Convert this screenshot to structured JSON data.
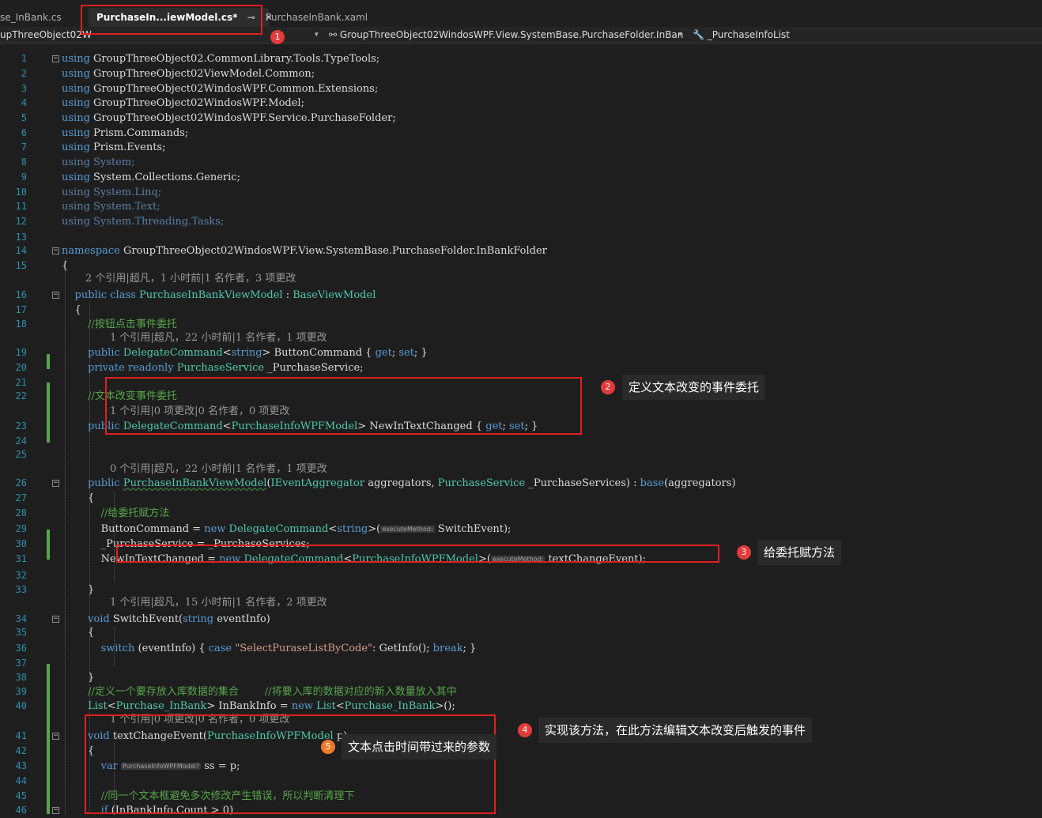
{
  "tabs": [
    {
      "label": "se_InBank.cs",
      "active": false
    },
    {
      "label": "PurchaseIn...iewModel.cs*",
      "active": true
    },
    {
      "label": "PurchaseInBank.xaml",
      "active": false
    }
  ],
  "tab_controls": {
    "pin": "⊸",
    "close": "✕"
  },
  "navbar": {
    "project": "upThreeObject02W",
    "class_path": "GroupThreeObject02WindosWPF.View.SystemBase.PurchaseFolder.InBan",
    "member": "_PurchaseInfoList"
  },
  "code_lines": [
    {
      "n": "1",
      "t": [
        [
          "kw",
          "using"
        ],
        [
          "id",
          " GroupThreeObject02.CommonLibrary.Tools.TypeTools;"
        ]
      ]
    },
    {
      "n": "2",
      "t": [
        [
          "kw",
          "using"
        ],
        [
          "id",
          " GroupThreeObject02ViewModel.Common;"
        ]
      ]
    },
    {
      "n": "3",
      "t": [
        [
          "kw",
          "using"
        ],
        [
          "id",
          " GroupThreeObject02WindosWPF.Common.Extensions;"
        ]
      ]
    },
    {
      "n": "4",
      "t": [
        [
          "kw",
          "using"
        ],
        [
          "id",
          " GroupThreeObject02WindosWPF.Model;"
        ]
      ]
    },
    {
      "n": "5",
      "t": [
        [
          "kw",
          "using"
        ],
        [
          "id",
          " GroupThreeObject02WindosWPF.Service.PurchaseFolder;"
        ]
      ]
    },
    {
      "n": "6",
      "t": [
        [
          "kw",
          "using"
        ],
        [
          "id",
          " Prism.Commands;"
        ]
      ]
    },
    {
      "n": "7",
      "t": [
        [
          "kw",
          "using"
        ],
        [
          "id",
          " Prism.Events;"
        ]
      ]
    },
    {
      "n": "8",
      "t": [
        [
          "dim",
          "using System;"
        ]
      ]
    },
    {
      "n": "9",
      "t": [
        [
          "kw",
          "using"
        ],
        [
          "id",
          " System.Collections.Generic;"
        ]
      ]
    },
    {
      "n": "10",
      "t": [
        [
          "dim",
          "using System.Linq;"
        ]
      ]
    },
    {
      "n": "11",
      "t": [
        [
          "dim",
          "using System.Text;"
        ]
      ]
    },
    {
      "n": "12",
      "t": [
        [
          "dim",
          "using System.Threading.Tasks;"
        ]
      ]
    },
    {
      "n": "13",
      "t": []
    },
    {
      "n": "14",
      "t": [
        [
          "kw",
          "namespace"
        ],
        [
          "id",
          " GroupThreeObject02WindosWPF.View.SystemBase.PurchaseFolder.InBankFolder"
        ]
      ]
    },
    {
      "n": "15",
      "t": [
        [
          "id",
          "{"
        ]
      ]
    },
    {
      "lens": "2 个引用|超凡，1 小时前|1 名作者，3 项更改",
      "indent": 2
    },
    {
      "n": "16",
      "t": [
        [
          "id",
          "    "
        ],
        [
          "kw",
          "public class"
        ],
        [
          "id",
          " "
        ],
        [
          "ty",
          "PurchaseInBankViewModel"
        ],
        [
          "id",
          " : "
        ],
        [
          "ty",
          "BaseViewModel"
        ]
      ]
    },
    {
      "n": "17",
      "t": [
        [
          "id",
          "    {"
        ]
      ]
    },
    {
      "n": "18",
      "t": [
        [
          "id",
          "        "
        ],
        [
          "cm",
          "//按钮点击事件委托"
        ]
      ]
    },
    {
      "lens": "1 个引用|超凡，22 小时前|1 名作者，1 项更改",
      "indent": 4
    },
    {
      "n": "19",
      "t": [
        [
          "id",
          "        "
        ],
        [
          "kw",
          "public"
        ],
        [
          "id",
          " "
        ],
        [
          "ty",
          "DelegateCommand"
        ],
        [
          "id",
          "<"
        ],
        [
          "kw",
          "string"
        ],
        [
          "id",
          "> ButtonCommand { "
        ],
        [
          "kw",
          "get"
        ],
        [
          "id",
          "; "
        ],
        [
          "kw",
          "set"
        ],
        [
          "id",
          "; }"
        ]
      ]
    },
    {
      "n": "20",
      "t": [
        [
          "id",
          "        "
        ],
        [
          "kw",
          "private readonly"
        ],
        [
          "id",
          " "
        ],
        [
          "ty",
          "PurchaseService"
        ],
        [
          "id",
          " _PurchaseService;"
        ]
      ]
    },
    {
      "n": "21",
      "t": []
    },
    {
      "n": "22",
      "t": [
        [
          "id",
          "        "
        ],
        [
          "cm",
          "//文本改变事件委托"
        ]
      ]
    },
    {
      "lens": "1 个引用|0 项更改|0 名作者，0 项更改",
      "indent": 4
    },
    {
      "n": "23",
      "t": [
        [
          "id",
          "        "
        ],
        [
          "kw",
          "public"
        ],
        [
          "id",
          " "
        ],
        [
          "ty",
          "DelegateCommand"
        ],
        [
          "id",
          "<"
        ],
        [
          "ty",
          "PurchaseInfoWPFModel"
        ],
        [
          "id",
          "> NewInTextChanged { "
        ],
        [
          "kw",
          "get"
        ],
        [
          "id",
          "; "
        ],
        [
          "kw",
          "set"
        ],
        [
          "id",
          "; }"
        ]
      ]
    },
    {
      "n": "24",
      "t": []
    },
    {
      "n": "25",
      "t": []
    },
    {
      "lens": "0 个引用|超凡，22 小时前|1 名作者，1 项更改",
      "indent": 4
    },
    {
      "n": "26",
      "t": [
        [
          "id",
          "        "
        ],
        [
          "kw",
          "public"
        ],
        [
          "id",
          " "
        ],
        [
          "ty",
          "PurchaseInBankViewModel"
        ],
        [
          "id",
          "("
        ],
        [
          "ty",
          "IEventAggregator"
        ],
        [
          "id",
          " aggregators, "
        ],
        [
          "ty",
          "PurchaseService"
        ],
        [
          "id",
          " _PurchaseServices) : "
        ],
        [
          "kw",
          "base"
        ],
        [
          "id",
          "(aggregators)"
        ]
      ]
    },
    {
      "n": "27",
      "t": [
        [
          "id",
          "        {"
        ]
      ]
    },
    {
      "n": "28",
      "t": [
        [
          "id",
          "            "
        ],
        [
          "cm",
          "//给委托赋方法"
        ]
      ]
    },
    {
      "n": "29",
      "t": [
        [
          "id",
          "            ButtonCommand = "
        ],
        [
          "kw",
          "new"
        ],
        [
          "id",
          " "
        ],
        [
          "ty",
          "DelegateCommand"
        ],
        [
          "id",
          "<"
        ],
        [
          "kw",
          "string"
        ],
        [
          "id",
          ">("
        ],
        [
          "hint",
          "executeMethod:"
        ],
        [
          "id",
          " SwitchEvent);"
        ]
      ]
    },
    {
      "n": "30",
      "t": [
        [
          "id",
          "            _PurchaseService = _PurchaseServices;"
        ]
      ]
    },
    {
      "n": "31",
      "t": [
        [
          "id",
          "            NewInTextChanged = "
        ],
        [
          "kw",
          "new"
        ],
        [
          "id",
          " "
        ],
        [
          "ty",
          "DelegateCommand"
        ],
        [
          "id",
          "<"
        ],
        [
          "ty",
          "PurchaseInfoWPFModel"
        ],
        [
          "id",
          ">("
        ],
        [
          "hint",
          "executeMethod:"
        ],
        [
          "id",
          " textChangeEvent);"
        ]
      ]
    },
    {
      "n": "32",
      "t": []
    },
    {
      "n": "33",
      "t": [
        [
          "id",
          "        }"
        ]
      ]
    },
    {
      "lens": "1 个引用|超凡，15 小时前|1 名作者，2 项更改",
      "indent": 4
    },
    {
      "n": "34",
      "t": [
        [
          "id",
          "        "
        ],
        [
          "kw",
          "void"
        ],
        [
          "id",
          " SwitchEvent("
        ],
        [
          "kw",
          "string"
        ],
        [
          "id",
          " eventInfo)"
        ]
      ]
    },
    {
      "n": "35",
      "t": [
        [
          "id",
          "        {"
        ]
      ]
    },
    {
      "n": "36",
      "t": [
        [
          "id",
          "            "
        ],
        [
          "kw",
          "switch"
        ],
        [
          "id",
          " (eventInfo) { "
        ],
        [
          "kw",
          "case"
        ],
        [
          "id",
          " "
        ],
        [
          "st",
          "\"SelectPuraseListByCode\""
        ],
        [
          "id",
          ": GetInfo(); "
        ],
        [
          "kw",
          "break"
        ],
        [
          "id",
          "; }"
        ]
      ]
    },
    {
      "n": "37",
      "t": []
    },
    {
      "n": "38",
      "t": [
        [
          "id",
          "        }"
        ]
      ]
    },
    {
      "n": "39",
      "t": [
        [
          "id",
          "        "
        ],
        [
          "cm",
          "//定义一个要存放入库数据的集合        //将要入库的数据对应的新入数量放入其中"
        ]
      ]
    },
    {
      "n": "40",
      "t": [
        [
          "id",
          "        "
        ],
        [
          "ty",
          "List"
        ],
        [
          "id",
          "<"
        ],
        [
          "ty",
          "Purchase_InBank"
        ],
        [
          "id",
          "> InBankInfo = "
        ],
        [
          "kw",
          "new"
        ],
        [
          "id",
          " "
        ],
        [
          "ty",
          "List"
        ],
        [
          "id",
          "<"
        ],
        [
          "ty",
          "Purchase_InBank"
        ],
        [
          "id",
          ">();"
        ]
      ]
    },
    {
      "lens": "1 个引用|0 项更改|0 名作者，0 项更改",
      "indent": 4
    },
    {
      "n": "41",
      "t": [
        [
          "id",
          "        "
        ],
        [
          "kw",
          "void"
        ],
        [
          "id",
          " textChangeEvent("
        ],
        [
          "ty",
          "PurchaseInfoWPFModel"
        ],
        [
          "id",
          " p)"
        ]
      ]
    },
    {
      "n": "42",
      "t": [
        [
          "id",
          "        {"
        ]
      ]
    },
    {
      "n": "43",
      "t": [
        [
          "id",
          "            "
        ],
        [
          "kw",
          "var"
        ],
        [
          "id",
          " "
        ],
        [
          "hint",
          "PurchaseInfoWPFModel?"
        ],
        [
          "id",
          " ss = p;"
        ]
      ]
    },
    {
      "n": "44",
      "t": []
    },
    {
      "n": "45",
      "t": [
        [
          "id",
          "            "
        ],
        [
          "cm",
          "//同一个文本框避免多次修改产生错误，所以判断清理下"
        ]
      ]
    },
    {
      "n": "46",
      "t": [
        [
          "id",
          "            "
        ],
        [
          "kw",
          "if"
        ],
        [
          "id",
          " (InBankInfo.Count > 0)"
        ]
      ]
    }
  ],
  "annotations": [
    {
      "num": "1",
      "text": ""
    },
    {
      "num": "2",
      "text": "定义文本改变的事件委托"
    },
    {
      "num": "3",
      "text": "给委托赋方法"
    },
    {
      "num": "4",
      "text": "实现该方法，在此方法编辑文本改变后触发的事件"
    },
    {
      "num": "5",
      "text": "文本点击时间带过来的参数"
    }
  ]
}
